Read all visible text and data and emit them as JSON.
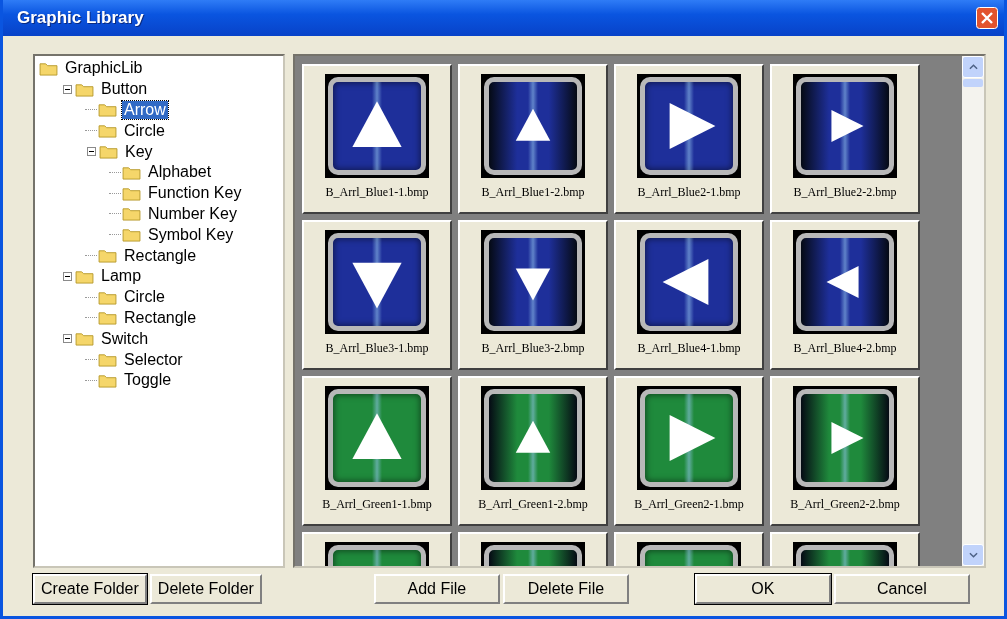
{
  "window": {
    "title": "Graphic Library"
  },
  "tree": [
    {
      "label": "GraphicLib",
      "selected": false,
      "children": [
        {
          "label": "Button",
          "selected": false,
          "expanded": true,
          "children": [
            {
              "label": "Arrow",
              "selected": true
            },
            {
              "label": "Circle",
              "selected": false
            },
            {
              "label": "Key",
              "selected": false,
              "expanded": true,
              "children": [
                {
                  "label": "Alphabet",
                  "selected": false
                },
                {
                  "label": "Function Key",
                  "selected": false
                },
                {
                  "label": "Number Key",
                  "selected": false
                },
                {
                  "label": "Symbol Key",
                  "selected": false
                }
              ]
            },
            {
              "label": "Rectangle",
              "selected": false
            }
          ]
        },
        {
          "label": "Lamp",
          "selected": false,
          "expanded": true,
          "children": [
            {
              "label": "Circle",
              "selected": false
            },
            {
              "label": "Rectangle",
              "selected": false
            }
          ]
        },
        {
          "label": "Switch",
          "selected": false,
          "expanded": true,
          "children": [
            {
              "label": "Selector",
              "selected": false
            },
            {
              "label": "Toggle",
              "selected": false
            }
          ]
        }
      ]
    }
  ],
  "files": [
    {
      "name": "B_Arrl_Blue1-1.bmp",
      "color": "#1e2f9a",
      "dark": false,
      "kind": "up"
    },
    {
      "name": "B_Arrl_Blue1-2.bmp",
      "color": "#1e2f9a",
      "dark": true,
      "kind": "up"
    },
    {
      "name": "B_Arrl_Blue2-1.bmp",
      "color": "#1e2f9a",
      "dark": false,
      "kind": "right"
    },
    {
      "name": "B_Arrl_Blue2-2.bmp",
      "color": "#1e2f9a",
      "dark": true,
      "kind": "right"
    },
    {
      "name": "B_Arrl_Blue3-1.bmp",
      "color": "#1e2f9a",
      "dark": false,
      "kind": "down"
    },
    {
      "name": "B_Arrl_Blue3-2.bmp",
      "color": "#1e2f9a",
      "dark": true,
      "kind": "down"
    },
    {
      "name": "B_Arrl_Blue4-1.bmp",
      "color": "#1e2f9a",
      "dark": false,
      "kind": "left"
    },
    {
      "name": "B_Arrl_Blue4-2.bmp",
      "color": "#1e2f9a",
      "dark": true,
      "kind": "left"
    },
    {
      "name": "B_Arrl_Green1-1.bmp",
      "color": "#1f8a3c",
      "dark": false,
      "kind": "up"
    },
    {
      "name": "B_Arrl_Green1-2.bmp",
      "color": "#1f8a3c",
      "dark": true,
      "kind": "up"
    },
    {
      "name": "B_Arrl_Green2-1.bmp",
      "color": "#1f8a3c",
      "dark": false,
      "kind": "right"
    },
    {
      "name": "B_Arrl_Green2-2.bmp",
      "color": "#1f8a3c",
      "dark": true,
      "kind": "right"
    },
    {
      "color": "#1f8a3c",
      "dark": false
    },
    {
      "color": "#1f8a3c",
      "dark": true
    },
    {
      "color": "#1f8a3c",
      "dark": false
    },
    {
      "color": "#1f8a3c",
      "dark": true
    }
  ],
  "tree_buttons": [
    {
      "label": "Create Folder",
      "default": true
    },
    {
      "label": "Delete Folder",
      "default": false
    }
  ],
  "file_buttons": [
    {
      "label": "Add File",
      "default": false
    },
    {
      "label": "Delete File",
      "default": false
    }
  ],
  "dialog_buttons": [
    {
      "label": "OK",
      "default": true
    },
    {
      "label": "Cancel",
      "default": false
    }
  ]
}
